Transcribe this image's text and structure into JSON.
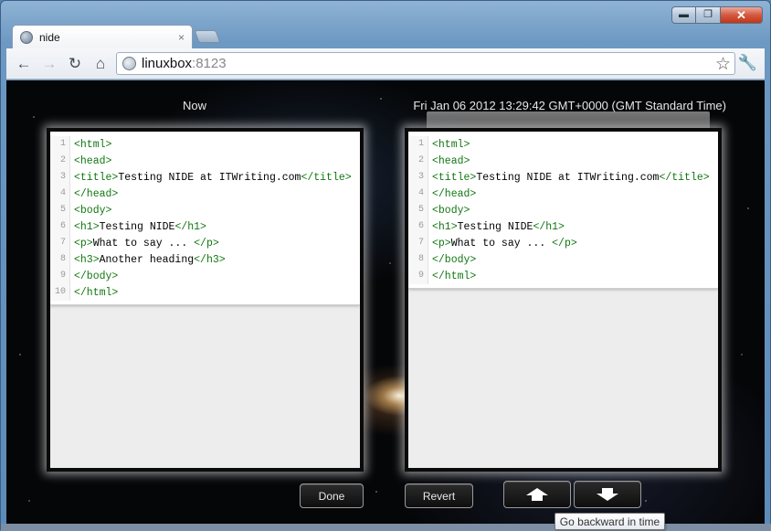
{
  "window": {
    "controls": {
      "minimize": "▬",
      "maximize": "❐",
      "close": "✕"
    }
  },
  "tab": {
    "title": "nide",
    "close": "×"
  },
  "toolbar": {
    "back": "←",
    "forward": "→",
    "reload": "↻",
    "home": "⌂",
    "url_host": "linuxbox",
    "url_port": ":8123",
    "star": "☆",
    "wrench": "🔧"
  },
  "panels": {
    "left_label": "Now",
    "right_label": "Fri Jan 06 2012 13:29:42 GMT+0000 (GMT Standard Time)",
    "left_lines": [
      {
        "n": "1",
        "pre": "",
        "tag1": "<html>",
        "text": "",
        "tag2": ""
      },
      {
        "n": "2",
        "pre": "",
        "tag1": "<head>",
        "text": "",
        "tag2": ""
      },
      {
        "n": "3",
        "pre": "",
        "tag1": "<title>",
        "text": "Testing NIDE at ITWriting.com",
        "tag2": "</title>"
      },
      {
        "n": "4",
        "pre": "",
        "tag1": "</head>",
        "text": "",
        "tag2": ""
      },
      {
        "n": "5",
        "pre": "",
        "tag1": "<body>",
        "text": "",
        "tag2": ""
      },
      {
        "n": "6",
        "pre": "",
        "tag1": "<h1>",
        "text": "Testing NIDE",
        "tag2": "</h1>"
      },
      {
        "n": "7",
        "pre": "",
        "tag1": "<p>",
        "text": "What to say ... ",
        "tag2": "</p>"
      },
      {
        "n": "8",
        "pre": "",
        "tag1": "<h3>",
        "text": "Another heading",
        "tag2": "</h3>"
      },
      {
        "n": "9",
        "pre": "",
        "tag1": "</body>",
        "text": "",
        "tag2": ""
      },
      {
        "n": "10",
        "pre": "",
        "tag1": "</html>",
        "text": "",
        "tag2": ""
      }
    ],
    "right_lines": [
      {
        "n": "1",
        "pre": "",
        "tag1": "<html>",
        "text": "",
        "tag2": ""
      },
      {
        "n": "2",
        "pre": "",
        "tag1": "<head>",
        "text": "",
        "tag2": ""
      },
      {
        "n": "3",
        "pre": "",
        "tag1": "<title>",
        "text": "Testing NIDE at ITWriting.com",
        "tag2": "</title>"
      },
      {
        "n": "4",
        "pre": "",
        "tag1": "</head>",
        "text": "",
        "tag2": ""
      },
      {
        "n": "5",
        "pre": "",
        "tag1": "<body>",
        "text": "",
        "tag2": ""
      },
      {
        "n": "6",
        "pre": "",
        "tag1": "<h1>",
        "text": "Testing NIDE",
        "tag2": "</h1>"
      },
      {
        "n": "7",
        "pre": "",
        "tag1": "<p>",
        "text": "What to say ... ",
        "tag2": "</p>"
      },
      {
        "n": "8",
        "pre": "",
        "tag1": "</body>",
        "text": "",
        "tag2": ""
      },
      {
        "n": "9",
        "pre": "",
        "tag1": "</html>",
        "text": "",
        "tag2": ""
      }
    ]
  },
  "buttons": {
    "done": "Done",
    "revert": "Revert"
  },
  "tooltip": {
    "text": "Go backward in time"
  },
  "colors": {
    "tag": "#117711",
    "background": "#050608"
  }
}
